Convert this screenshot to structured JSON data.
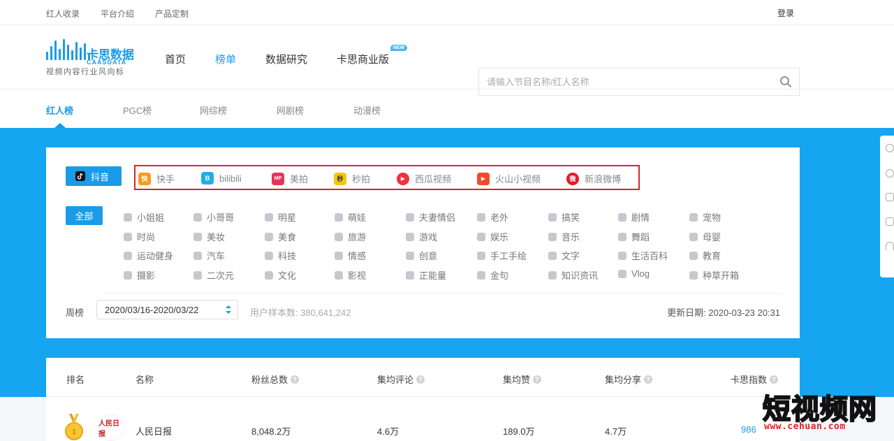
{
  "topbar": {
    "links": [
      "红人收录",
      "平台介绍",
      "产品定制"
    ],
    "login": "登录"
  },
  "logo": {
    "name_cn": "卡思数据",
    "name_en": "CAASDATA",
    "slogan": "视频内容行业风向标"
  },
  "nav": {
    "items": [
      "首页",
      "榜单",
      "数据研究",
      "卡思商业版"
    ],
    "active_index": 1,
    "new_badge": "NEW"
  },
  "search": {
    "placeholder": "请输入节目名称/红人名称",
    "icon": "search-icon"
  },
  "subtabs": {
    "items": [
      "红人榜",
      "PGC榜",
      "网综榜",
      "网剧榜",
      "动漫榜"
    ],
    "active_index": 0
  },
  "platforms": {
    "active": "抖音",
    "items": [
      {
        "label": "快手",
        "color": "#f59a23",
        "glyph": "快"
      },
      {
        "label": "bilibili",
        "color": "#23ade5",
        "glyph": "B"
      },
      {
        "label": "美拍",
        "color": "#e8335c",
        "glyph": "MP"
      },
      {
        "label": "秒拍",
        "color": "#f5c518",
        "glyph": "秒"
      },
      {
        "label": "西瓜视频",
        "color": "#f0313f",
        "glyph": "▶"
      },
      {
        "label": "火山小视频",
        "color": "#f24a2c",
        "glyph": "▶"
      },
      {
        "label": "新浪微博",
        "color": "#e6162d",
        "glyph": "微"
      }
    ]
  },
  "categories": {
    "all_label": "全部",
    "items": [
      "小姐姐",
      "小哥哥",
      "明星",
      "萌娃",
      "夫妻情侣",
      "老外",
      "搞笑",
      "剧情",
      "宠物",
      "时尚",
      "美妆",
      "美食",
      "旅游",
      "游戏",
      "娱乐",
      "音乐",
      "舞蹈",
      "母婴",
      "运动健身",
      "汽车",
      "科技",
      "情感",
      "创意",
      "手工手绘",
      "文字",
      "生活百科",
      "教育",
      "摄影",
      "二次元",
      "文化",
      "影视",
      "正能量",
      "金句",
      "知识资讯",
      "Vlog",
      "种草开箱"
    ]
  },
  "period": {
    "label": "周榜",
    "range": "2020/03/16-2020/03/22",
    "sample": "用户样本数: 380,641,242",
    "updated": "更新日期: 2020-03-23 20:31"
  },
  "table": {
    "headers": [
      "排名",
      "名称",
      "粉丝总数",
      "集均评论",
      "集均赞",
      "集均分享",
      "卡思指数"
    ],
    "help_mark": "?",
    "rows": [
      {
        "rank": 1,
        "medal_number": "1",
        "avatar_text": "人民日报",
        "name": "人民日报",
        "fans": "8,048.2万",
        "comments": "4.6万",
        "likes": "189.0万",
        "shares": "4.7万",
        "index": "986"
      }
    ]
  },
  "watermark": {
    "text_cn": "短视频网",
    "url": "www.cehuan.com"
  },
  "colors": {
    "accent": "#1a9be8",
    "band": "#16a5f0",
    "highlight_box": "#d9232d"
  }
}
